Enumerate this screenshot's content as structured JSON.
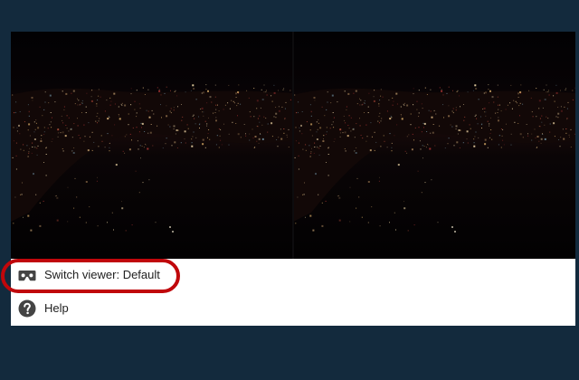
{
  "vr_view": {
    "left_eye_icon": "city-night-panorama",
    "right_eye_icon": "city-night-panorama"
  },
  "menu": {
    "items": [
      {
        "label": "Switch viewer: Default",
        "icon": "cardboard-viewer-icon"
      },
      {
        "label": "Help",
        "icon": "help-icon"
      }
    ]
  },
  "colors": {
    "background": "#132a3d",
    "highlight_ring": "#c0070b",
    "menu_text": "#212121",
    "icon": "#444444"
  }
}
